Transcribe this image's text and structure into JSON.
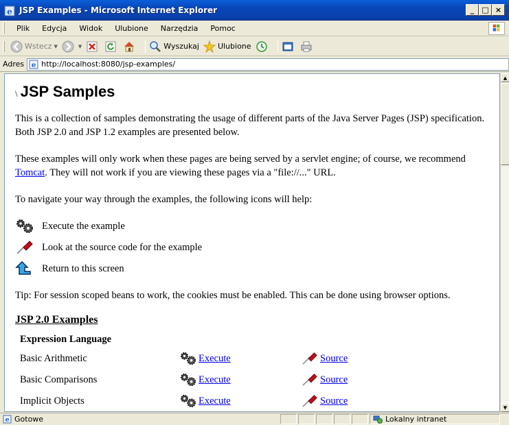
{
  "window": {
    "title": "JSP Examples - Microsoft Internet Explorer",
    "minimize": "_",
    "maximize": "□",
    "close": "×"
  },
  "menu": {
    "items": [
      {
        "label": "Plik"
      },
      {
        "label": "Edycja"
      },
      {
        "label": "Widok"
      },
      {
        "label": "Ulubione"
      },
      {
        "label": "Narzędzia"
      },
      {
        "label": "Pomoc"
      }
    ]
  },
  "toolbar": {
    "back": "Wstecz",
    "search": "Wyszukaj",
    "favorites": "Ulubione"
  },
  "address": {
    "label": "Adres",
    "url": "http://localhost:8080/jsp-examples/"
  },
  "page": {
    "heading_prefix": "\\",
    "heading": "JSP Samples",
    "intro": "This is a collection of samples demonstrating the usage of different parts of the Java Server Pages (JSP) specification. Both JSP 2.0 and JSP 1.2 examples are presented below.",
    "work_pre": "These examples will only work when these pages are being served by a servlet engine; of course, we recommend ",
    "work_link": "Tomcat",
    "work_post": ". They will not work if you are viewing these pages via a \"file://...\" URL.",
    "navigate": "To navigate your way through the examples, the following icons will help:",
    "legend": {
      "execute": "Execute the example",
      "source": "Look at the source code for the example",
      "return": "Return to this screen"
    },
    "tip": "Tip: For session scoped beans to work, the cookies must be enabled. This can be done using browser options.",
    "section_title": "JSP 2.0 Examples",
    "category": "Expression Language",
    "rows": [
      {
        "label": "Basic Arithmetic",
        "execute": "Execute",
        "source": "Source"
      },
      {
        "label": "Basic Comparisons",
        "execute": "Execute",
        "source": "Source"
      },
      {
        "label": "Implicit Objects",
        "execute": "Execute",
        "source": "Source"
      }
    ]
  },
  "status": {
    "text": "Gotowe",
    "zone": "Lokalny intranet"
  }
}
